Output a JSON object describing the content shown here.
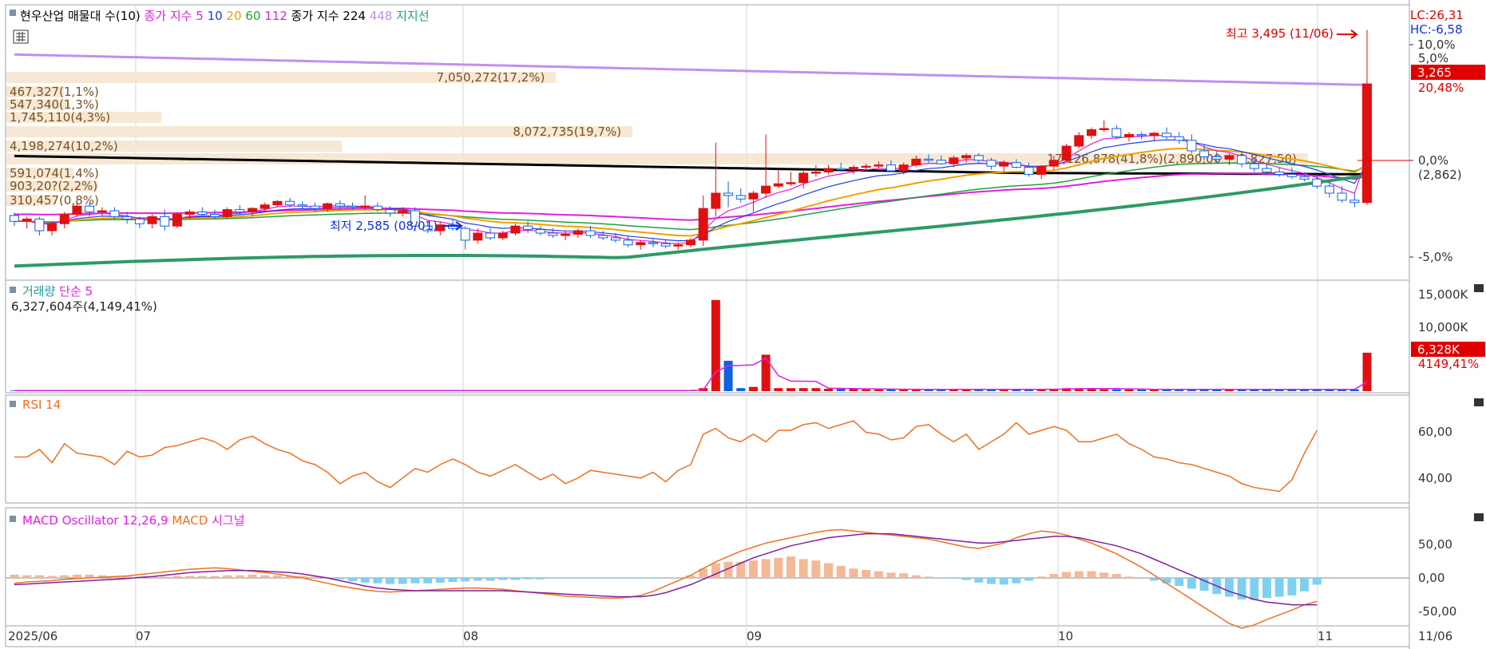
{
  "legend": {
    "main": [
      {
        "text": "현우산업 매물대 수(10)",
        "color": "#000000"
      },
      {
        "text": "종가 지수 5",
        "color": "#e020e0"
      },
      {
        "text": "10",
        "color": "#2040e0"
      },
      {
        "text": "20",
        "color": "#f0a000"
      },
      {
        "text": "60",
        "color": "#20a040"
      },
      {
        "text": "112",
        "color": "#e020e0"
      },
      {
        "text": "종가 지수 224",
        "color": "#000000"
      },
      {
        "text": "448",
        "color": "#c090f0"
      },
      {
        "text": "지지선",
        "color": "#20a080"
      }
    ],
    "volume": [
      {
        "text": "거래량",
        "color": "#20a0a0"
      },
      {
        "text": "단순 5",
        "color": "#e020e0"
      }
    ],
    "rsi": [
      {
        "text": "RSI 14",
        "color": "#f07020"
      }
    ],
    "macd": [
      {
        "text": "MACD Oscillator 12,26,9",
        "color": "#e020e0"
      },
      {
        "text": "MACD",
        "color": "#f07020"
      },
      {
        "text": "시그널",
        "color": "#e020e0"
      }
    ]
  },
  "axis": {
    "lc": "LC:26,31",
    "hc": "HC:-6,58",
    "price_ticks": [
      "10,0%",
      "5,0%",
      "0,0%",
      "(2,862)",
      "-5,0%"
    ],
    "current_price": "3,265",
    "current_pct": "20,48%",
    "volume_ticks": [
      "15,000K",
      "10,000K"
    ],
    "volume_current": "6,328K",
    "volume_pct": "4149,41%",
    "rsi_ticks": [
      "60,00",
      "40,00"
    ],
    "macd_ticks": [
      "50,00",
      "0,00",
      "-50,00"
    ],
    "x_labels": [
      "2025/06",
      "07",
      "08",
      "09",
      "10",
      "11",
      "11/06"
    ]
  },
  "annotations": {
    "high": "최고 3,495 (11/06)",
    "low": "최저 2,585 (08/01)",
    "volume_info": "6,327,604주(4,149,41%)"
  },
  "volume_profile": [
    {
      "label": "7,050,272(17,2%)",
      "pct": 17.2
    },
    {
      "label": "467,327(1,1%)",
      "pct": 1.1
    },
    {
      "label": "547,340(1,3%)",
      "pct": 1.3
    },
    {
      "label": "1,745,110(4,3%)",
      "pct": 4.3
    },
    {
      "label": "8,072,735(19,7%)",
      "pct": 19.7
    },
    {
      "label": "4,198,274(10,2%)",
      "pct": 10.2
    },
    {
      "label": "17,126,878(41,8%)(2,890,00 ~ 2,827,50)",
      "pct": 41.8
    },
    {
      "label": "591,074(1,4%)",
      "pct": 1.4
    },
    {
      "label": "903,20?(2,2%)",
      "pct": 2.2
    },
    {
      "label": "310,457(0,8%)",
      "pct": 0.8
    }
  ],
  "chart_data": {
    "type": "candlestick",
    "y_range": [
      2450,
      3520
    ],
    "price_levels": {
      "high": 3495,
      "low": 2585,
      "last": 3265,
      "base": 2862
    },
    "candles": [
      [
        2705,
        2718,
        2660,
        2680
      ],
      [
        2680,
        2700,
        2650,
        2690
      ],
      [
        2690,
        2700,
        2620,
        2640
      ],
      [
        2640,
        2680,
        2620,
        2670
      ],
      [
        2670,
        2720,
        2650,
        2710
      ],
      [
        2710,
        2760,
        2700,
        2745
      ],
      [
        2745,
        2760,
        2700,
        2720
      ],
      [
        2720,
        2740,
        2700,
        2725
      ],
      [
        2725,
        2740,
        2690,
        2700
      ],
      [
        2700,
        2720,
        2670,
        2690
      ],
      [
        2690,
        2700,
        2650,
        2670
      ],
      [
        2670,
        2710,
        2650,
        2700
      ],
      [
        2700,
        2730,
        2640,
        2660
      ],
      [
        2660,
        2720,
        2650,
        2710
      ],
      [
        2710,
        2730,
        2690,
        2720
      ],
      [
        2720,
        2740,
        2700,
        2710
      ],
      [
        2710,
        2730,
        2690,
        2700
      ],
      [
        2700,
        2740,
        2690,
        2730
      ],
      [
        2730,
        2750,
        2710,
        2720
      ],
      [
        2720,
        2740,
        2700,
        2735
      ],
      [
        2735,
        2760,
        2720,
        2750
      ],
      [
        2750,
        2770,
        2740,
        2765
      ],
      [
        2765,
        2780,
        2740,
        2750
      ],
      [
        2750,
        2765,
        2730,
        2745
      ],
      [
        2745,
        2760,
        2720,
        2735
      ],
      [
        2735,
        2760,
        2720,
        2755
      ],
      [
        2755,
        2770,
        2730,
        2745
      ],
      [
        2745,
        2760,
        2730,
        2740
      ],
      [
        2740,
        2790,
        2730,
        2745
      ],
      [
        2745,
        2760,
        2720,
        2730
      ],
      [
        2730,
        2745,
        2700,
        2715
      ],
      [
        2715,
        2740,
        2700,
        2725
      ],
      [
        2725,
        2740,
        2640,
        2660
      ],
      [
        2660,
        2680,
        2630,
        2640
      ],
      [
        2640,
        2680,
        2620,
        2665
      ],
      [
        2665,
        2690,
        2640,
        2650
      ],
      [
        2650,
        2660,
        2560,
        2600
      ],
      [
        2600,
        2650,
        2585,
        2630
      ],
      [
        2630,
        2650,
        2600,
        2610
      ],
      [
        2610,
        2640,
        2600,
        2630
      ],
      [
        2630,
        2670,
        2620,
        2660
      ],
      [
        2660,
        2680,
        2630,
        2645
      ],
      [
        2645,
        2660,
        2620,
        2630
      ],
      [
        2630,
        2650,
        2610,
        2620
      ],
      [
        2620,
        2640,
        2600,
        2625
      ],
      [
        2625,
        2650,
        2610,
        2640
      ],
      [
        2640,
        2660,
        2610,
        2620
      ],
      [
        2620,
        2640,
        2600,
        2610
      ],
      [
        2610,
        2630,
        2590,
        2600
      ],
      [
        2600,
        2620,
        2570,
        2580
      ],
      [
        2580,
        2600,
        2560,
        2590
      ],
      [
        2590,
        2610,
        2570,
        2585
      ],
      [
        2585,
        2600,
        2565,
        2575
      ],
      [
        2575,
        2590,
        2560,
        2580
      ],
      [
        2580,
        2610,
        2570,
        2600
      ],
      [
        2600,
        2790,
        2575,
        2735
      ],
      [
        2735,
        3015,
        2700,
        2800
      ],
      [
        2800,
        2850,
        2740,
        2790
      ],
      [
        2790,
        2820,
        2760,
        2775
      ],
      [
        2775,
        2810,
        2720,
        2800
      ],
      [
        2800,
        3050,
        2780,
        2830
      ],
      [
        2830,
        2900,
        2820,
        2840
      ],
      [
        2840,
        2890,
        2830,
        2845
      ],
      [
        2845,
        2900,
        2820,
        2885
      ],
      [
        2885,
        2920,
        2870,
        2890
      ],
      [
        2890,
        2920,
        2880,
        2905
      ],
      [
        2905,
        2930,
        2890,
        2900
      ],
      [
        2900,
        2920,
        2880,
        2910
      ],
      [
        2910,
        2925,
        2895,
        2915
      ],
      [
        2915,
        2935,
        2905,
        2920
      ],
      [
        2920,
        2940,
        2890,
        2895
      ],
      [
        2895,
        2930,
        2880,
        2920
      ],
      [
        2920,
        2960,
        2910,
        2945
      ],
      [
        2945,
        2965,
        2930,
        2940
      ],
      [
        2940,
        2960,
        2920,
        2925
      ],
      [
        2925,
        2960,
        2910,
        2950
      ],
      [
        2950,
        2970,
        2930,
        2960
      ],
      [
        2960,
        2970,
        2930,
        2940
      ],
      [
        2940,
        2950,
        2900,
        2915
      ],
      [
        2915,
        2940,
        2890,
        2930
      ],
      [
        2930,
        2945,
        2905,
        2910
      ],
      [
        2910,
        2930,
        2870,
        2880
      ],
      [
        2880,
        2920,
        2860,
        2915
      ],
      [
        2915,
        2960,
        2900,
        2940
      ],
      [
        2940,
        3010,
        2930,
        3000
      ],
      [
        3000,
        3060,
        2990,
        3045
      ],
      [
        3045,
        3080,
        3030,
        3070
      ],
      [
        3070,
        3110,
        3060,
        3075
      ],
      [
        3075,
        3090,
        3030,
        3040
      ],
      [
        3040,
        3060,
        3020,
        3050
      ],
      [
        3050,
        3060,
        3030,
        3045
      ],
      [
        3045,
        3060,
        3020,
        3055
      ],
      [
        3055,
        3080,
        3030,
        3040
      ],
      [
        3040,
        3060,
        3010,
        3025
      ],
      [
        3025,
        3050,
        2970,
        2980
      ],
      [
        2980,
        3010,
        2940,
        2955
      ],
      [
        2955,
        2980,
        2930,
        2945
      ],
      [
        2945,
        2970,
        2920,
        2960
      ],
      [
        2960,
        2980,
        2910,
        2925
      ],
      [
        2925,
        2950,
        2890,
        2905
      ],
      [
        2905,
        2930,
        2880,
        2890
      ],
      [
        2890,
        2910,
        2870,
        2880
      ],
      [
        2880,
        2910,
        2860,
        2870
      ],
      [
        2870,
        2890,
        2850,
        2860
      ],
      [
        2860,
        2880,
        2820,
        2830
      ],
      [
        2830,
        2850,
        2780,
        2800
      ],
      [
        2800,
        2830,
        2760,
        2770
      ],
      [
        2770,
        2800,
        2740,
        2760
      ],
      [
        2760,
        3495,
        2750,
        3265
      ]
    ],
    "volume": [
      0.1,
      0.1,
      0.1,
      0.1,
      0.1,
      0.1,
      0.1,
      0.1,
      0.1,
      0.1,
      0.1,
      0.1,
      0.1,
      0.1,
      0.1,
      0.1,
      0.1,
      0.1,
      0.1,
      0.1,
      0.1,
      0.1,
      0.1,
      0.1,
      0.1,
      0.1,
      0.1,
      0.1,
      0.1,
      0.1,
      0.1,
      0.1,
      0.1,
      0.1,
      0.1,
      0.1,
      0.1,
      0.1,
      0.1,
      0.1,
      0.1,
      0.1,
      0.1,
      0.1,
      0.1,
      0.1,
      0.1,
      0.1,
      0.1,
      0.1,
      0.1,
      0.1,
      0.1,
      0.1,
      0.2,
      0.5,
      15,
      5,
      0.5,
      0.7,
      6,
      0.5,
      0.5,
      0.5,
      0.5,
      0.4,
      0.4,
      0.4,
      0.3,
      0.3,
      0.3,
      0.3,
      0.3,
      0.3,
      0.3,
      0.3,
      0.3,
      0.3,
      0.3,
      0.3,
      0.3,
      0.3,
      0.3,
      0.4,
      0.5,
      0.5,
      0.5,
      0.3,
      0.3,
      0.3,
      0.3,
      0.3,
      0.3,
      0.3,
      0.3,
      0.3,
      0.3,
      0.3,
      0.3,
      0.3,
      0.3,
      0.3,
      0.3,
      0.3,
      0.3,
      0.3,
      0.3,
      0.3,
      6.33
    ],
    "rsi": [
      48,
      48,
      52,
      45,
      55,
      50,
      49,
      48,
      44,
      51,
      48,
      49,
      53,
      54,
      56,
      58,
      56,
      52,
      57,
      59,
      55,
      52,
      50,
      46,
      44,
      40,
      34,
      38,
      40,
      35,
      32,
      37,
      42,
      40,
      44,
      47,
      44,
      40,
      38,
      41,
      44,
      40,
      36,
      39,
      34,
      37,
      41,
      40,
      39,
      38,
      37,
      40,
      35,
      41,
      44,
      60,
      63,
      58,
      56,
      60,
      56,
      62,
      62,
      65,
      66,
      63,
      65,
      67,
      61,
      60,
      57,
      58,
      64,
      65,
      60,
      56,
      60,
      52,
      56,
      60,
      66,
      60,
      62,
      64,
      62,
      56,
      56,
      58,
      60,
      55,
      52,
      48,
      47,
      45,
      44,
      42,
      40,
      38,
      34,
      32,
      31,
      30,
      36,
      50,
      62
    ],
    "macd_osc": [
      5,
      4,
      4,
      3,
      4,
      5,
      5,
      4,
      3,
      2,
      2,
      2,
      2,
      3,
      3,
      3,
      3,
      4,
      4,
      5,
      4,
      4,
      3,
      3,
      2,
      1,
      -2,
      -5,
      -7,
      -8,
      -9,
      -9,
      -8,
      -8,
      -7,
      -6,
      -5,
      -4,
      -4,
      -3,
      -3,
      -2,
      -2,
      -1,
      -1,
      -1,
      -1,
      -1,
      -1,
      -1,
      -1,
      -1,
      0,
      0,
      4,
      14,
      22,
      24,
      24,
      26,
      28,
      30,
      32,
      28,
      26,
      22,
      18,
      14,
      12,
      10,
      8,
      7,
      4,
      2,
      1,
      -1,
      -3,
      -7,
      -9,
      -10,
      -8,
      -4,
      2,
      6,
      9,
      10,
      10,
      8,
      6,
      2,
      0,
      -4,
      -8,
      -12,
      -16,
      -19,
      -24,
      -28,
      -32,
      -33,
      -30,
      -28,
      -26,
      -20,
      -10
    ],
    "macd": [
      -8,
      -6,
      -5,
      -4,
      -2,
      -1,
      0,
      1,
      2,
      3,
      5,
      7,
      9,
      11,
      13,
      14,
      15,
      14,
      12,
      10,
      8,
      6,
      3,
      0,
      -4,
      -8,
      -12,
      -15,
      -18,
      -20,
      -21,
      -20,
      -19,
      -18,
      -17,
      -16,
      -15,
      -15,
      -16,
      -17,
      -19,
      -21,
      -23,
      -25,
      -27,
      -28,
      -29,
      -30,
      -30,
      -29,
      -26,
      -20,
      -12,
      -4,
      4,
      14,
      24,
      32,
      40,
      46,
      52,
      56,
      60,
      64,
      68,
      71,
      72,
      70,
      68,
      66,
      64,
      62,
      60,
      58,
      54,
      50,
      46,
      44,
      48,
      52,
      60,
      66,
      70,
      68,
      64,
      58,
      52,
      44,
      36,
      26,
      16,
      4,
      -8,
      -20,
      -32,
      -44,
      -56,
      -68,
      -75,
      -70,
      -62,
      -55,
      -48,
      -40,
      -35
    ],
    "signal": [
      -10,
      -9,
      -8,
      -7,
      -6,
      -5,
      -4,
      -3,
      -2,
      -1,
      1,
      2,
      4,
      6,
      8,
      9,
      10,
      11,
      11,
      11,
      10,
      9,
      8,
      6,
      3,
      0,
      -4,
      -8,
      -12,
      -15,
      -17,
      -18,
      -19,
      -19,
      -19,
      -19,
      -19,
      -19,
      -19,
      -19,
      -20,
      -21,
      -22,
      -23,
      -24,
      -25,
      -26,
      -27,
      -28,
      -28,
      -28,
      -26,
      -22,
      -16,
      -10,
      -2,
      6,
      14,
      22,
      30,
      36,
      42,
      48,
      52,
      56,
      60,
      62,
      64,
      66,
      66,
      66,
      64,
      62,
      60,
      58,
      56,
      54,
      52,
      52,
      54,
      56,
      58,
      60,
      62,
      62,
      60,
      56,
      52,
      48,
      42,
      36,
      28,
      20,
      12,
      4,
      -4,
      -12,
      -20,
      -26,
      -32,
      -36,
      -38,
      -40,
      -40,
      -40
    ]
  }
}
